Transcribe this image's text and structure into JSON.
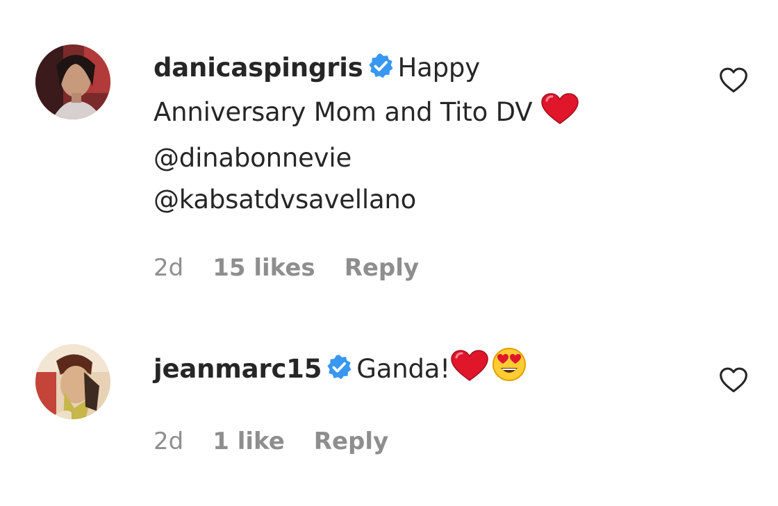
{
  "comments": [
    {
      "username": "danicaspingris",
      "text_line1": "Happy",
      "text_line2": "Anniversary Mom and Tito DV",
      "mention1": "@dinabonnevie",
      "mention2": "@kabsatdvsavellano",
      "time": "2d",
      "likes": "15 likes",
      "reply": "Reply",
      "emoji": [
        "red-heart"
      ]
    },
    {
      "username": "jeanmarc15",
      "text": "Ganda!",
      "time": "2d",
      "likes": "1 like",
      "reply": "Reply",
      "emoji": [
        "red-heart",
        "heart-eyes-face"
      ]
    }
  ],
  "colors": {
    "text": "#262626",
    "meta": "#8e8e8e",
    "verified": "#3897f0",
    "heart": "#e0162b"
  },
  "icons": [
    "avatar",
    "verified-badge-icon",
    "red-heart-emoji-icon",
    "heart-eyes-emoji-icon",
    "like-heart-icon"
  ]
}
